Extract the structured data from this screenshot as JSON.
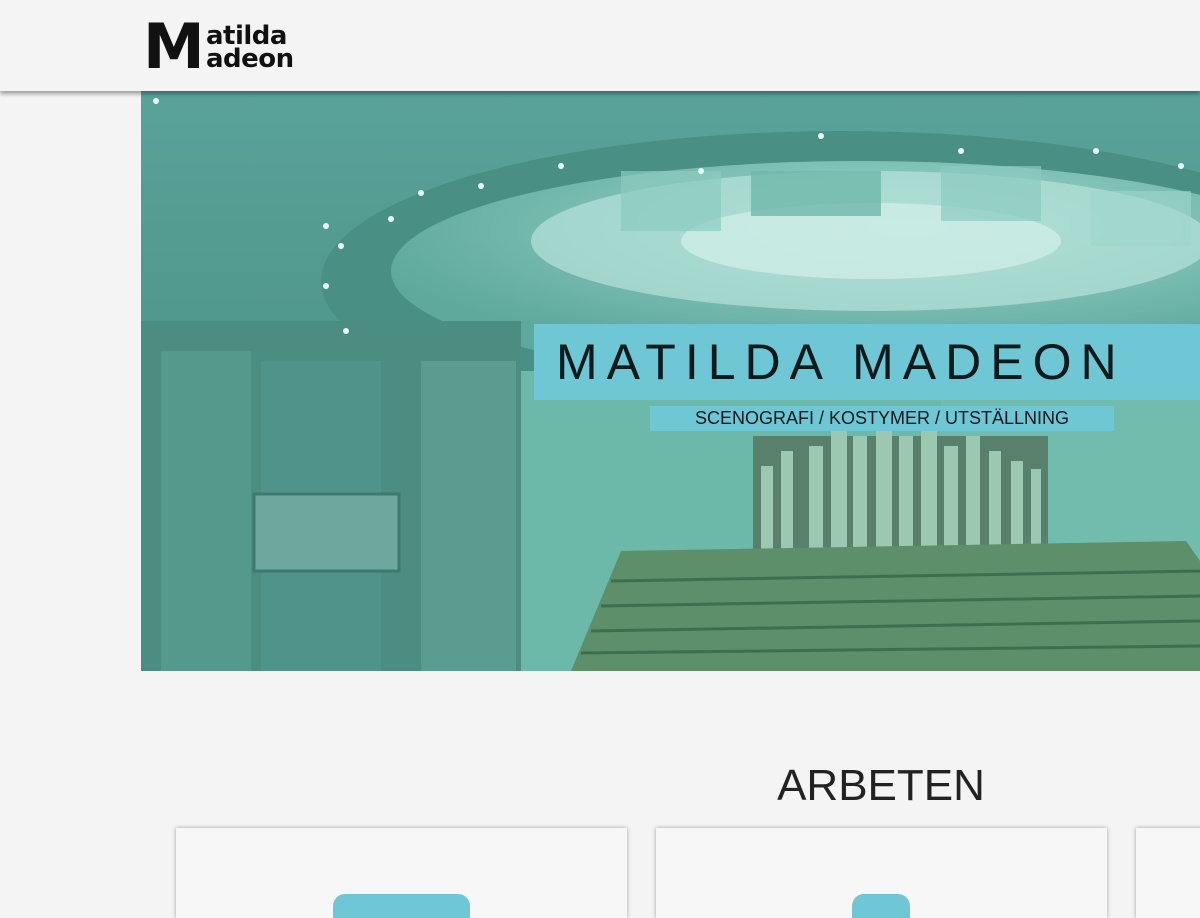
{
  "header": {
    "logo_initial": "M",
    "logo_line1": "atilda",
    "logo_line2": "adeon"
  },
  "hero": {
    "title": "MATILDA MADEON",
    "subtitle": "SCENOGRAFI / KOSTYMER / UTSTÄLLNING",
    "image_overlay_color": "#4f9d92",
    "label_background": "#6fc6d4"
  },
  "works": {
    "heading": "ARBETEN"
  },
  "colors": {
    "page_background": "#f4f4f4",
    "accent": "#6fc6d4",
    "text": "#222222"
  }
}
